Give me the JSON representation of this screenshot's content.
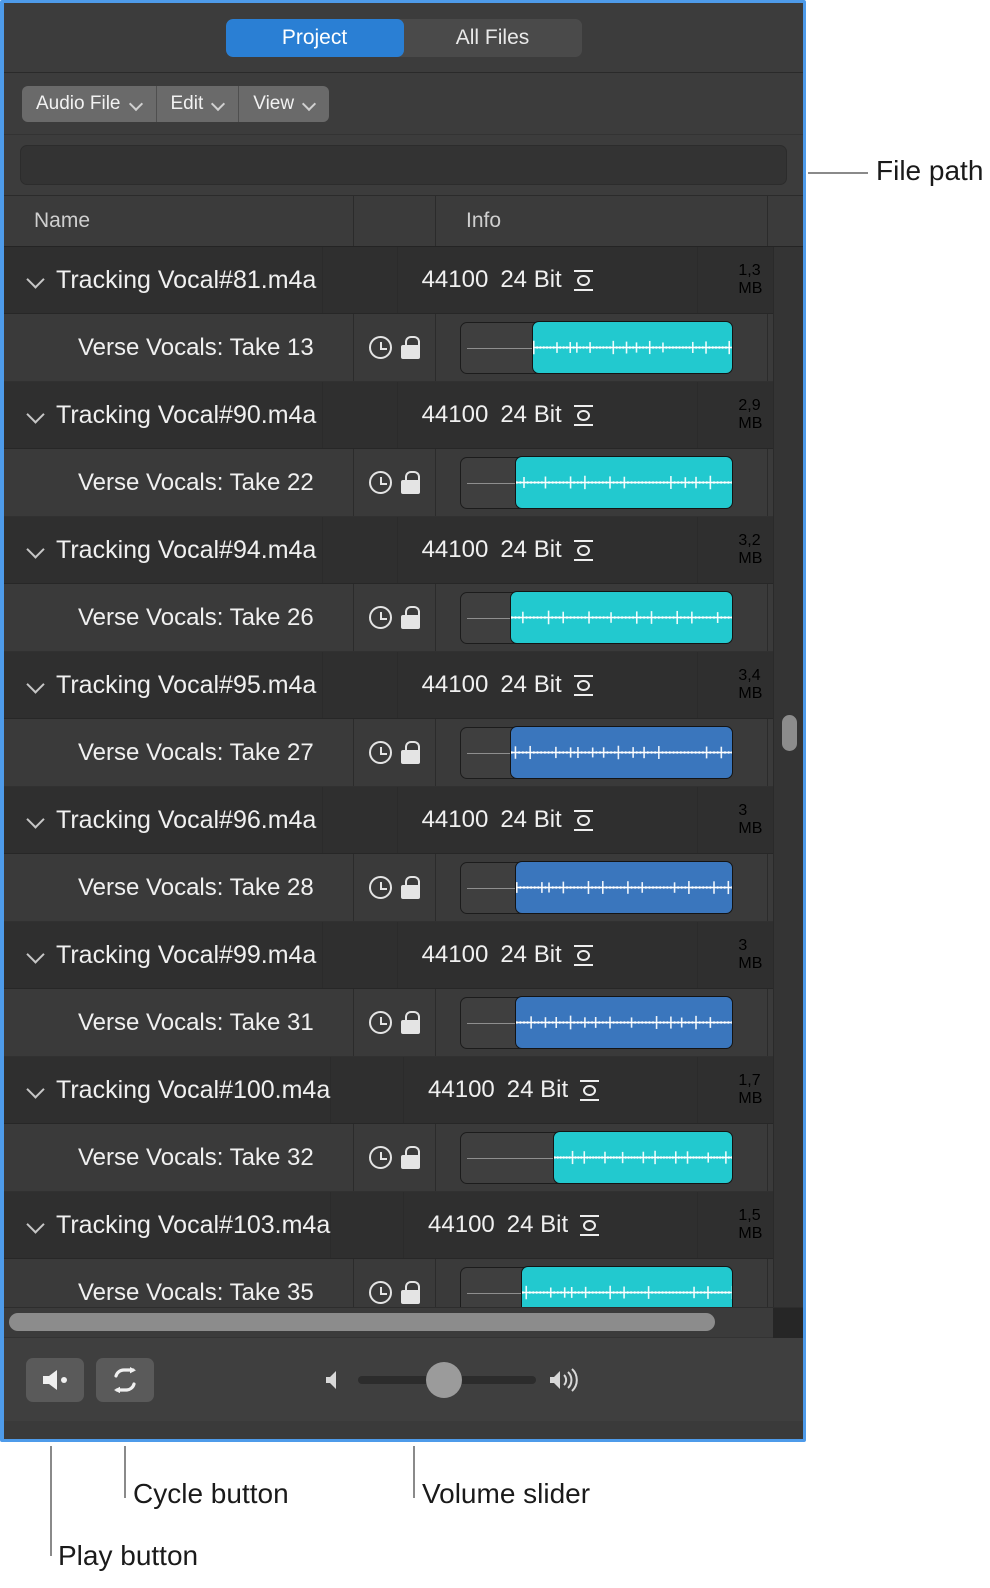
{
  "window": {
    "border_color": "#4e9bea",
    "tabs": [
      {
        "label": "Project",
        "active": true
      },
      {
        "label": "All Files",
        "active": false
      }
    ],
    "menus": [
      {
        "label": "Audio File"
      },
      {
        "label": "Edit"
      },
      {
        "label": "View"
      }
    ],
    "path_field": {
      "value": "",
      "placeholder": ""
    }
  },
  "table": {
    "columns": [
      {
        "label": "Name"
      },
      {
        "label": ""
      },
      {
        "label": "Info"
      },
      {
        "label": ""
      }
    ],
    "rows": [
      {
        "file": "Tracking Vocal#81.m4a",
        "sample_rate": "44100",
        "bit_depth": "24 Bit",
        "channel_icon": "mono-icon",
        "size": "1,3 MB",
        "overflow_char": "'",
        "take": "Verse Vocals: Take 13",
        "flags": [
          "clock-icon",
          "lock-icon"
        ],
        "waveform": {
          "color": "#22c9cf",
          "selection_start_pct": 26
        }
      },
      {
        "file": "Tracking Vocal#90.m4a",
        "sample_rate": "44100",
        "bit_depth": "24 Bit",
        "channel_icon": "mono-icon",
        "size": "2,9 MB",
        "overflow_char": "'",
        "take": "Verse Vocals: Take 22",
        "flags": [
          "clock-icon",
          "lock-icon"
        ],
        "waveform": {
          "color": "#22c9cf",
          "selection_start_pct": 20
        }
      },
      {
        "file": "Tracking Vocal#94.m4a",
        "sample_rate": "44100",
        "bit_depth": "24 Bit",
        "channel_icon": "mono-icon",
        "size": "3,2 MB",
        "overflow_char": "'",
        "take": "Verse Vocals: Take 26",
        "flags": [
          "clock-icon",
          "lock-icon"
        ],
        "waveform": {
          "color": "#22c9cf",
          "selection_start_pct": 18
        }
      },
      {
        "file": "Tracking Vocal#95.m4a",
        "sample_rate": "44100",
        "bit_depth": "24 Bit",
        "channel_icon": "mono-icon",
        "size": "3,4 MB",
        "overflow_char": "'",
        "take": "Verse Vocals: Take 27",
        "flags": [
          "clock-icon",
          "lock-icon"
        ],
        "waveform": {
          "color": "#3a76bd",
          "selection_start_pct": 18
        }
      },
      {
        "file": "Tracking Vocal#96.m4a",
        "sample_rate": "44100",
        "bit_depth": "24 Bit",
        "channel_icon": "mono-icon",
        "size": "3 MB",
        "overflow_char": "'",
        "take": "Verse Vocals: Take 28",
        "flags": [
          "clock-icon",
          "lock-icon"
        ],
        "waveform": {
          "color": "#3a76bd",
          "selection_start_pct": 20
        }
      },
      {
        "file": "Tracking Vocal#99.m4a",
        "sample_rate": "44100",
        "bit_depth": "24 Bit",
        "channel_icon": "mono-icon",
        "size": "3 MB",
        "overflow_char": "'",
        "take": "Verse Vocals: Take 31",
        "flags": [
          "clock-icon",
          "lock-icon"
        ],
        "waveform": {
          "color": "#3a76bd",
          "selection_start_pct": 20
        }
      },
      {
        "file": "Tracking Vocal#100.m4a",
        "sample_rate": "44100",
        "bit_depth": "24 Bit",
        "channel_icon": "mono-icon",
        "size": "1,7 MB",
        "overflow_char": "'",
        "take": "Verse Vocals: Take 32",
        "flags": [
          "clock-icon",
          "lock-icon"
        ],
        "waveform": {
          "color": "#22c9cf",
          "selection_start_pct": 34
        }
      },
      {
        "file": "Tracking Vocal#103.m4a",
        "sample_rate": "44100",
        "bit_depth": "24 Bit",
        "channel_icon": "mono-icon",
        "size": "1,5 MB",
        "overflow_char": "'",
        "take": "Verse Vocals: Take 35",
        "flags": [
          "clock-icon",
          "lock-icon"
        ],
        "waveform": {
          "color": "#22c9cf",
          "selection_start_pct": 22
        }
      }
    ]
  },
  "toolbar": {
    "play_button": "play-icon",
    "cycle_button": "cycle-icon",
    "volume": {
      "min_icon": "speaker-low-icon",
      "max_icon": "speaker-high-icon",
      "value_pct": 50
    }
  },
  "callouts": [
    {
      "label": "File path"
    },
    {
      "label": "Cycle button"
    },
    {
      "label": "Volume slider"
    },
    {
      "label": "Play button"
    }
  ]
}
